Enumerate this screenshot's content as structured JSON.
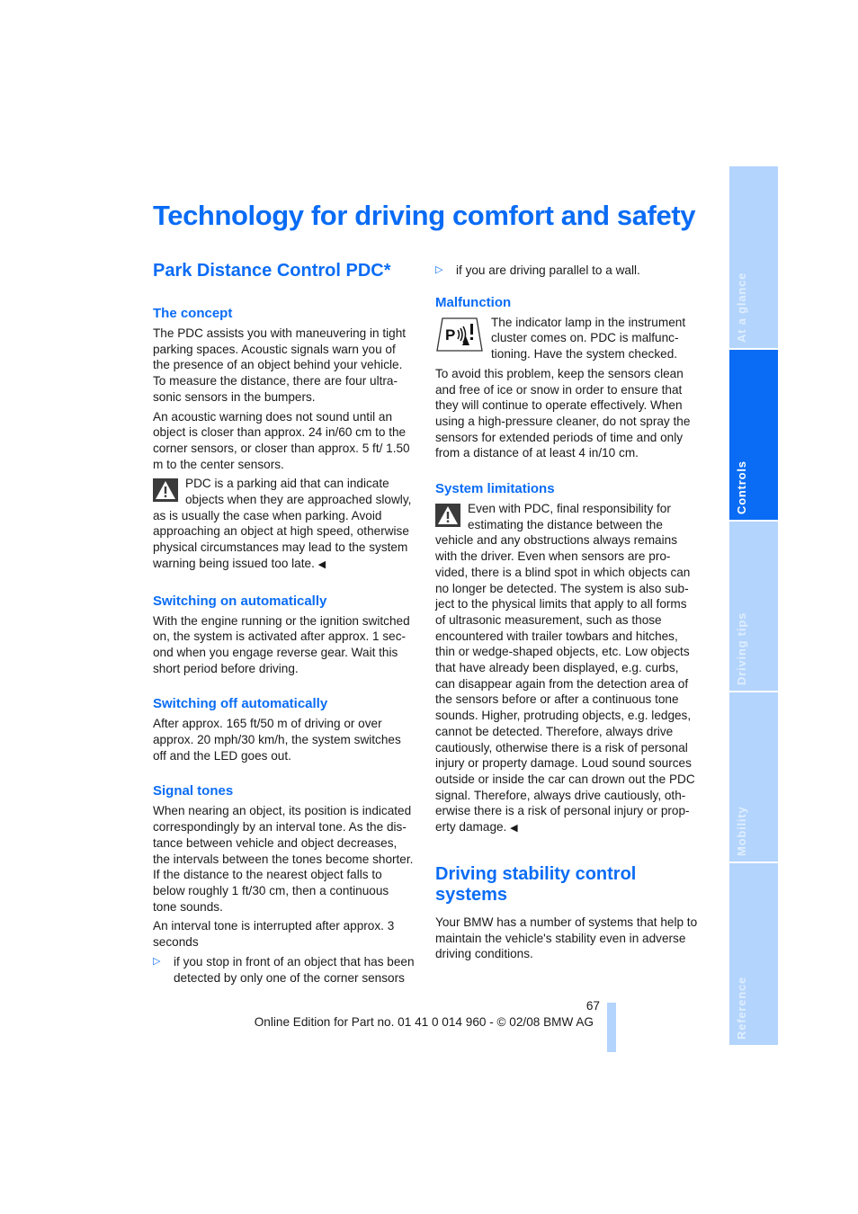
{
  "page": {
    "title": "Technology for driving comfort and safety",
    "page_number": "67",
    "footer": "Online Edition for Part no. 01 41 0 014 960 - © 02/08 BMW AG",
    "accent_color": "#0a6cf5",
    "tab_inactive_color": "#b3d4fc"
  },
  "side_tabs": [
    {
      "label": "At a glance",
      "active": false
    },
    {
      "label": "Controls",
      "active": true
    },
    {
      "label": "Driving tips",
      "active": false
    },
    {
      "label": "Mobility",
      "active": false
    },
    {
      "label": "Reference",
      "active": false
    }
  ],
  "pdc": {
    "heading": "Park Distance Control PDC*",
    "concept": {
      "heading": "The concept",
      "p1": "The PDC assists you with maneuvering in tight parking spaces. Acoustic signals warn you of the presence of an object behind your vehicle. To measure the distance, there are four ultra­sonic sensors in the bumpers.",
      "p2": "An acoustic warning does not sound until an object is closer than approx. 24 in/60 cm to the corner sensors, or closer than approx. 5 ft/ 1.50 m to the center sensors.",
      "warning": "PDC is a parking aid that can indicate objects when they are approached slowly, as is usually the case when parking. Avoid approaching an object at high speed, oth­erwise physical circumstances may lead to the system warning being issued too late.",
      "warning_icon": "warning-triangle-icon",
      "end_mark": "◀"
    },
    "switch_on": {
      "heading": "Switching on automatically",
      "text": "With the engine running or the ignition switched on, the system is activated after approx. 1 sec­ond when you engage reverse gear. Wait this short period before driving."
    },
    "switch_off": {
      "heading": "Switching off automatically",
      "text": "After approx. 165 ft/50 m of driving or over approx. 20 mph/30 km/h, the system switches off and the LED goes out."
    },
    "signal_tones": {
      "heading": "Signal tones",
      "p1": "When nearing an object, its position is indicated correspondingly by an interval tone. As the dis­tance between vehicle and object decreases, the intervals between the tones become shorter. If the distance to the nearest object falls to below roughly 1 ft/30 cm, then a contin­uous tone sounds.",
      "p2": "An interval tone is interrupted after approx. 3 seconds",
      "bullets": [
        "if you stop in front of an object that has been detected by only one of the corner sensors",
        "if you are driving parallel to a wall."
      ],
      "bullet_icon": "▷"
    },
    "malfunction": {
      "heading": "Malfunction",
      "indicator_text": "The indicator lamp in the instrument cluster comes on. PDC is malfunc­tioning. Have the system checked.",
      "indicator_icon_label": "P",
      "p1": "To avoid this problem, keep the sensors clean and free of ice or snow in order to ensure that they will continue to operate effectively. When using a high-pressure cleaner, do not spray the sensors for extended periods of time and only from a distance of at least 4 in/10 cm."
    },
    "limitations": {
      "heading": "System limitations",
      "warning": "Even with PDC, final responsibility for estimating the distance between the vehicle and any obstructions always remains with the driver. Even when sensors are pro­vided, there is a blind spot in which objects can no longer be detected. The system is also sub­ject to the physical limits that apply to all forms of ultrasonic measurement, such as those encountered with trailer towbars and hitches, thin or wedge-shaped objects, etc. Low objects that have already been displayed, e.g. curbs, can disappear again from the detection area of the sensors before or after a continuous tone sounds. Higher, protruding objects, e.g. ledges, cannot be detected. Therefore, always drive cautiously, otherwise there is a risk of personal injury or property damage. Loud sound sources outside or inside the car can drown out the PDC signal. Therefore, always drive cautiously, oth­erwise there is a risk of personal injury or prop­erty damage.",
      "end_mark": "◀"
    }
  },
  "stability": {
    "heading": "Driving stability control systems",
    "text": "Your BMW has a number of systems that help to maintain the vehicle's stability even in adverse driving conditions."
  }
}
